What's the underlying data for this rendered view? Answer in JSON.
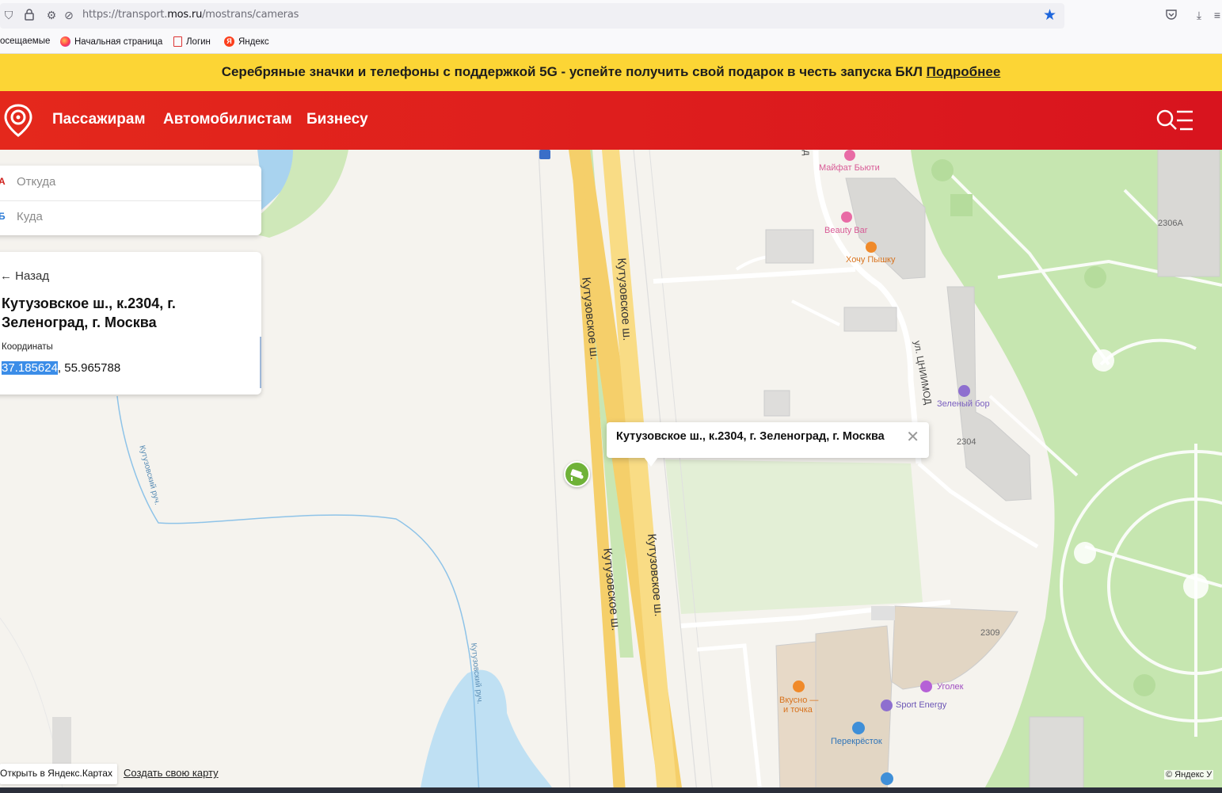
{
  "browser": {
    "url_prefix": "https://transport.",
    "url_host": "mos.ru",
    "url_path": "/mostrans/cameras",
    "bookmarks": [
      "осещаемые",
      "Начальная страница",
      "Логин",
      "Яндекс"
    ]
  },
  "banner": {
    "text": "Серебряные значки и телефоны с поддержкой 5G - успейте получить свой подарок в честь запуска БКЛ ",
    "link": "Подробнее"
  },
  "nav": {
    "items": [
      "Пассажирам",
      "Автомобилистам",
      "Бизнесу"
    ]
  },
  "route": {
    "from_mark": "A",
    "from_placeholder": "Откуда",
    "to_mark": "Б",
    "to_placeholder": "Куда"
  },
  "info": {
    "back": "← Назад",
    "address": "Кутузовское ш., к.2304, г. Зеленоград, г. Москва",
    "coords_label": "Координаты",
    "coord_lon": "37.185624",
    "coord_sep": ", ",
    "coord_lat": "55.965788"
  },
  "popup": {
    "text": "Кутузовское ш., к.2304, г. Зеленоград, г. Москва",
    "close": "✕"
  },
  "map": {
    "roads": [
      "Кутузовское ш.",
      "Кутузовское ш.",
      "Кутузовское ш.",
      "Кутузовское ш.",
      "ул. ЦНИИМОД",
      "Кутузовский руч.",
      "Кутузовский руч.",
      "од"
    ],
    "pois": [
      "Майфат Бьюти",
      "Beauty Bar",
      "Хочу Пышку",
      "Зеленый бор",
      "Уголек",
      "Sport Energy",
      "Вкусно —",
      "и точка",
      "Перекрёсток"
    ],
    "buildings": [
      "2306А",
      "2304",
      "2309"
    ]
  },
  "footer": {
    "open_yandex": "Открыть в Яндекс.Картах",
    "create_map": "Создать свою карту",
    "copyright": "© Яндекс У"
  },
  "colors": {
    "banner": "#fcd535",
    "nav": "#e0201d",
    "camera": "#6fb238",
    "selection": "#3b8de8"
  }
}
